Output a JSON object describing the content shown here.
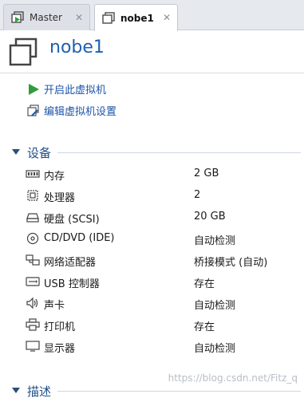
{
  "tabs": [
    {
      "label": "Master",
      "close": "✕"
    },
    {
      "label": "nobe1",
      "close": "✕"
    }
  ],
  "vm": {
    "title": "nobe1"
  },
  "actions": {
    "power_on": "开启此虚拟机",
    "edit_settings": "编辑虚拟机设置"
  },
  "devices_section": {
    "label": "设备"
  },
  "devices": [
    {
      "name": "内存",
      "value": "2 GB",
      "icon": "memory-icon"
    },
    {
      "name": "处理器",
      "value": "2",
      "icon": "cpu-icon"
    },
    {
      "name": "硬盘 (SCSI)",
      "value": "20 GB",
      "icon": "hard-disk-icon"
    },
    {
      "name": "CD/DVD (IDE)",
      "value": "自动检测",
      "icon": "cd-dvd-icon"
    },
    {
      "name": "网络适配器",
      "value": "桥接模式 (自动)",
      "icon": "network-adapter-icon"
    },
    {
      "name": "USB 控制器",
      "value": "存在",
      "icon": "usb-icon"
    },
    {
      "name": "声卡",
      "value": "自动检测",
      "icon": "sound-card-icon"
    },
    {
      "name": "打印机",
      "value": "存在",
      "icon": "printer-icon"
    },
    {
      "name": "显示器",
      "value": "自动检测",
      "icon": "display-icon"
    }
  ],
  "description_section": {
    "label": "描述"
  },
  "watermark": "https://blog.csdn.net/Fitz_q",
  "colors": {
    "accent": "#1f5fb0",
    "link": "#1f56a8",
    "play_green": "#2e9e3a"
  }
}
